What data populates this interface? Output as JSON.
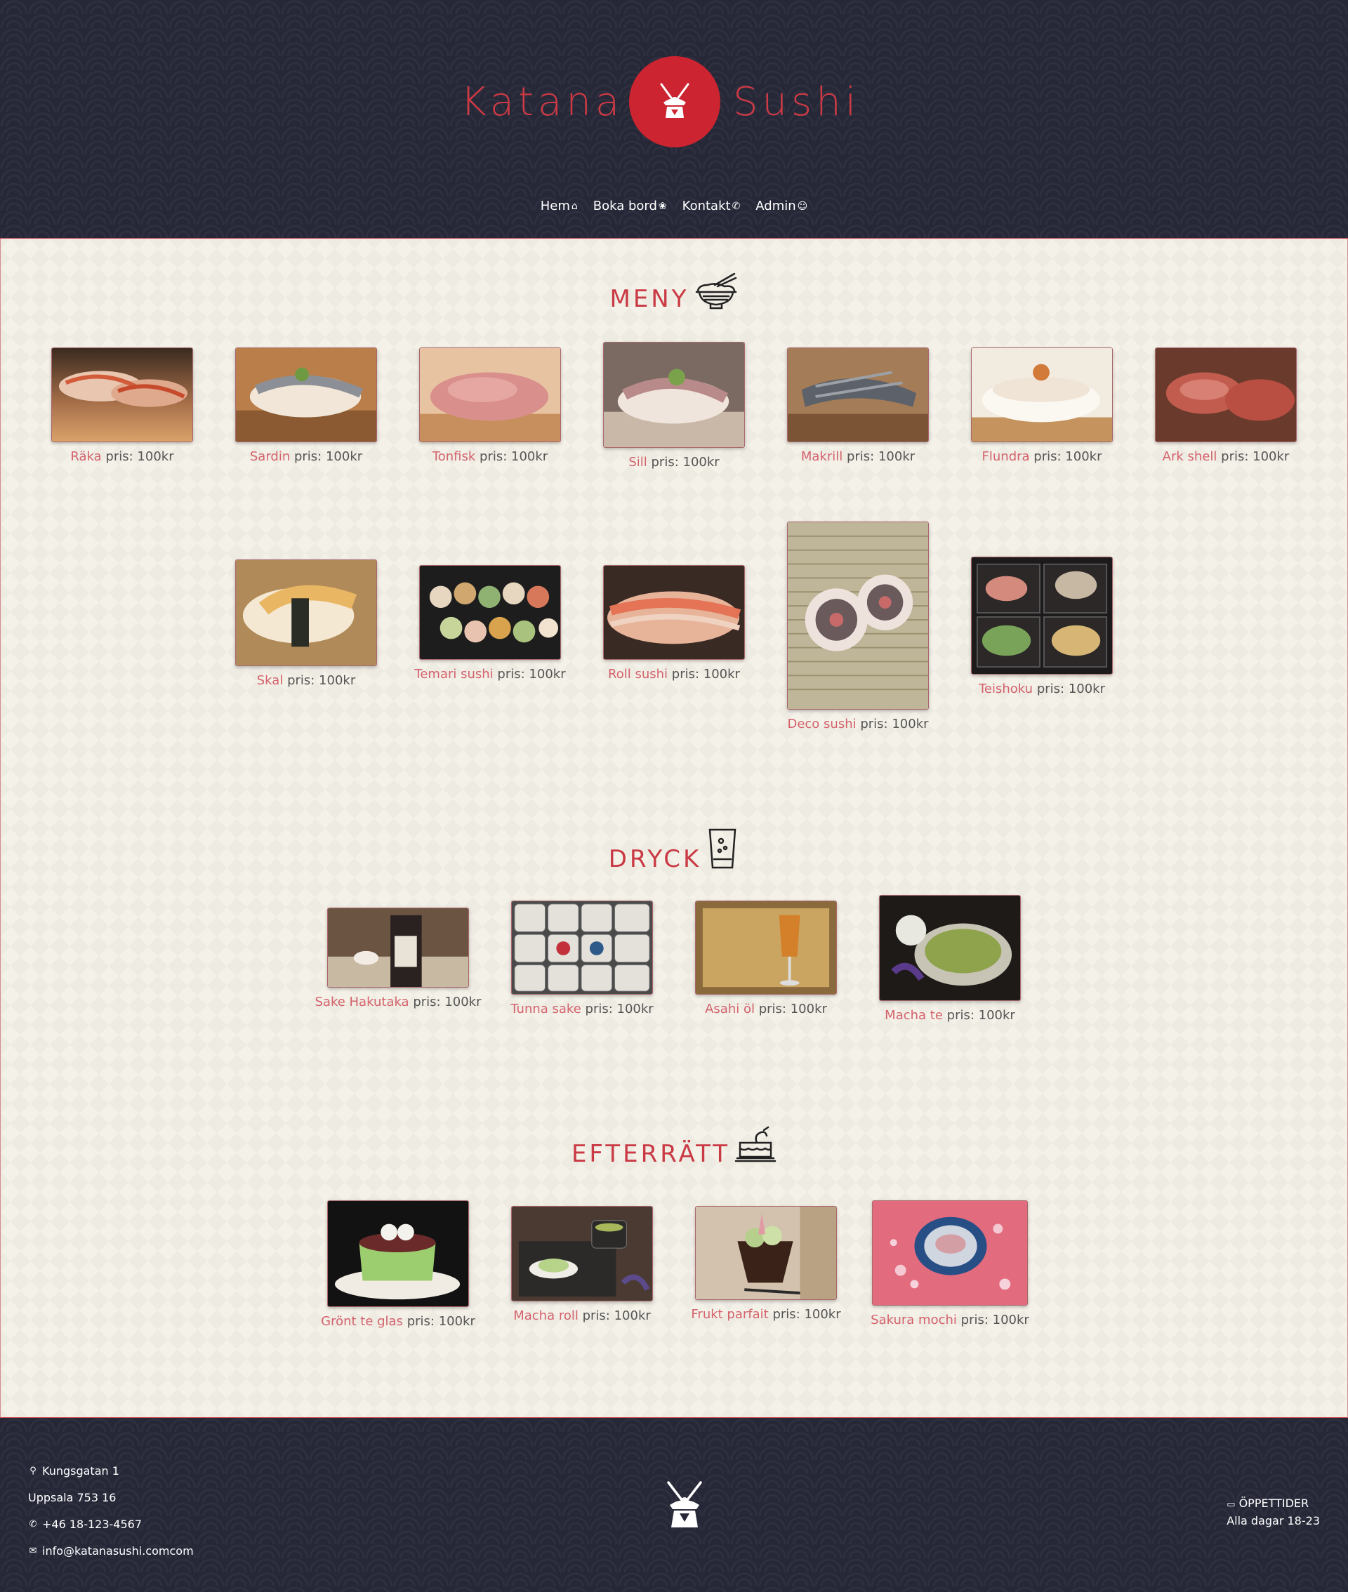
{
  "brand": {
    "left": "Katana",
    "right": "Sushi",
    "color": "#cc2430"
  },
  "nav": [
    {
      "label": "Hem",
      "icon": "home-icon",
      "glyph": "⌂"
    },
    {
      "label": "Boka bord",
      "icon": "sushi-tray-icon",
      "glyph": "❀"
    },
    {
      "label": "Kontakt",
      "icon": "phone-icon",
      "glyph": "✆"
    },
    {
      "label": "Admin",
      "icon": "admin-icon",
      "glyph": "☺"
    }
  ],
  "sections": {
    "meny": {
      "title": "MENY",
      "icon": "ramen-bowl-icon",
      "items": [
        {
          "name": "Räka",
          "price": "pris: 100kr"
        },
        {
          "name": "Sardin",
          "price": "pris: 100kr"
        },
        {
          "name": "Tonfisk",
          "price": "pris: 100kr"
        },
        {
          "name": "Sill",
          "price": "pris: 100kr"
        },
        {
          "name": "Makrill",
          "price": "pris: 100kr"
        },
        {
          "name": "Flundra",
          "price": "pris: 100kr"
        },
        {
          "name": "Ark shell",
          "price": "pris: 100kr"
        },
        {
          "name": "Skal",
          "price": "pris: 100kr"
        },
        {
          "name": "Temari sushi",
          "price": "pris: 100kr"
        },
        {
          "name": "Roll sushi",
          "price": "pris: 100kr"
        },
        {
          "name": "Deco sushi",
          "price": "pris: 100kr"
        },
        {
          "name": "Teishoku",
          "price": "pris: 100kr"
        }
      ]
    },
    "dryck": {
      "title": "DRYCK",
      "icon": "glass-icon",
      "items": [
        {
          "name": "Sake Hakutaka",
          "price": "pris: 100kr"
        },
        {
          "name": "Tunna sake",
          "price": "pris: 100kr"
        },
        {
          "name": "Asahi öl",
          "price": "pris: 100kr"
        },
        {
          "name": "Macha te",
          "price": "pris: 100kr"
        }
      ]
    },
    "efterratt": {
      "title": "EFTERRÄTT",
      "icon": "cake-icon",
      "items": [
        {
          "name": "Grönt te glas",
          "price": "pris: 100kr"
        },
        {
          "name": "Macha roll",
          "price": "pris: 100kr"
        },
        {
          "name": "Frukt parfait",
          "price": "pris: 100kr"
        },
        {
          "name": "Sakura mochi",
          "price": "pris: 100kr"
        }
      ]
    }
  },
  "footer": {
    "address_line1": "Kungsgatan 1",
    "address_line2": "Uppsala 753 16",
    "phone": "+46 18-123-4567",
    "email": "info@katanasushi.comcom",
    "hours_title": "ÖPPETTIDER",
    "hours_value": "Alla dagar 18-23"
  },
  "colors": {
    "accent": "#c93a44",
    "dark_bg": "#262838",
    "paper_bg": "#f4f1e8"
  }
}
